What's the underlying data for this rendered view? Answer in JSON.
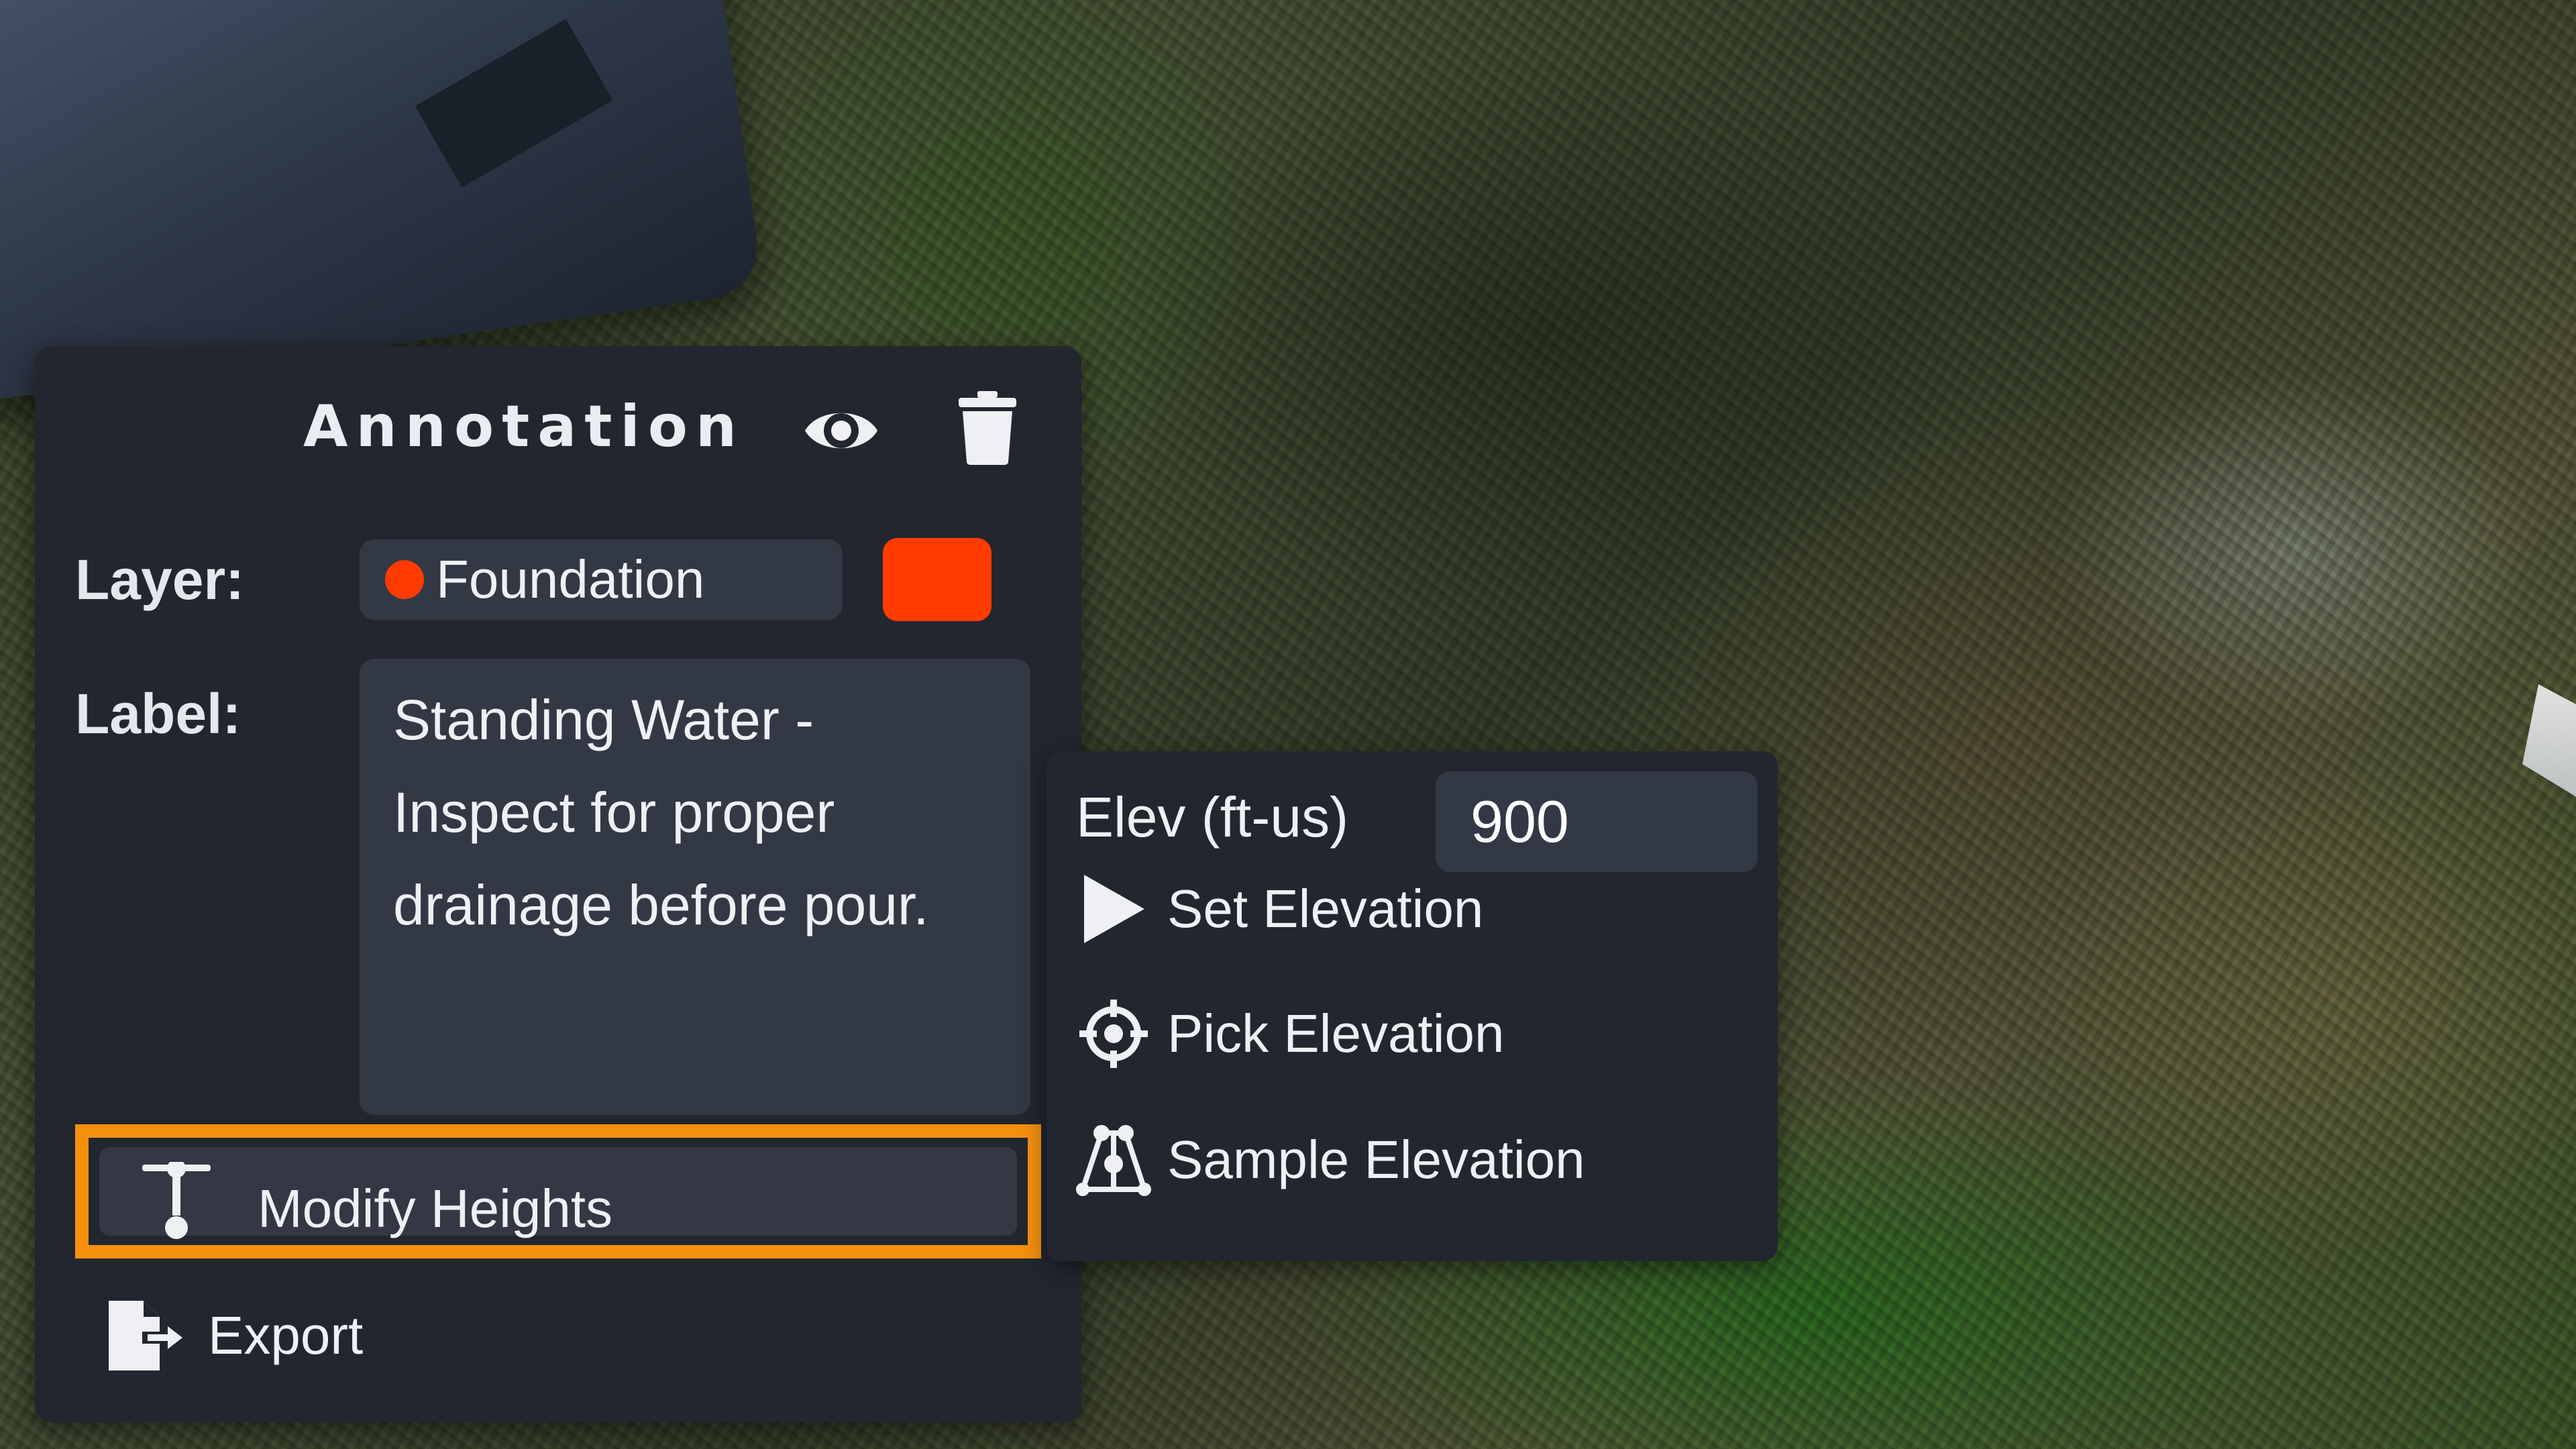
{
  "panel": {
    "title": "Annotation",
    "visibility_icon": "eye-icon",
    "delete_icon": "trash-icon",
    "layer_label": "Layer:",
    "layer_value": "Foundation",
    "layer_color": "#ff3b00",
    "text_label": "Label:",
    "text_value": "Standing Water -\nInspect for proper\ndrainage before pour.",
    "menu": {
      "modify_heights": "Modify Heights",
      "modify_heights_icon": "height-pin-icon",
      "export": "Export",
      "export_icon": "export-file-icon"
    }
  },
  "elevation_menu": {
    "elev_label": "Elev (ft-us)",
    "elev_value": "900",
    "set_elevation": "Set Elevation",
    "set_elevation_icon": "play-icon",
    "pick_elevation": "Pick Elevation",
    "pick_elevation_icon": "crosshair-icon",
    "sample_elevation": "Sample Elevation",
    "sample_elevation_icon": "sample-points-icon"
  },
  "colors": {
    "panel_bg": "#22262f",
    "field_bg": "#333845",
    "highlight": "#f5900f",
    "layer_color": "#ff3b00"
  }
}
